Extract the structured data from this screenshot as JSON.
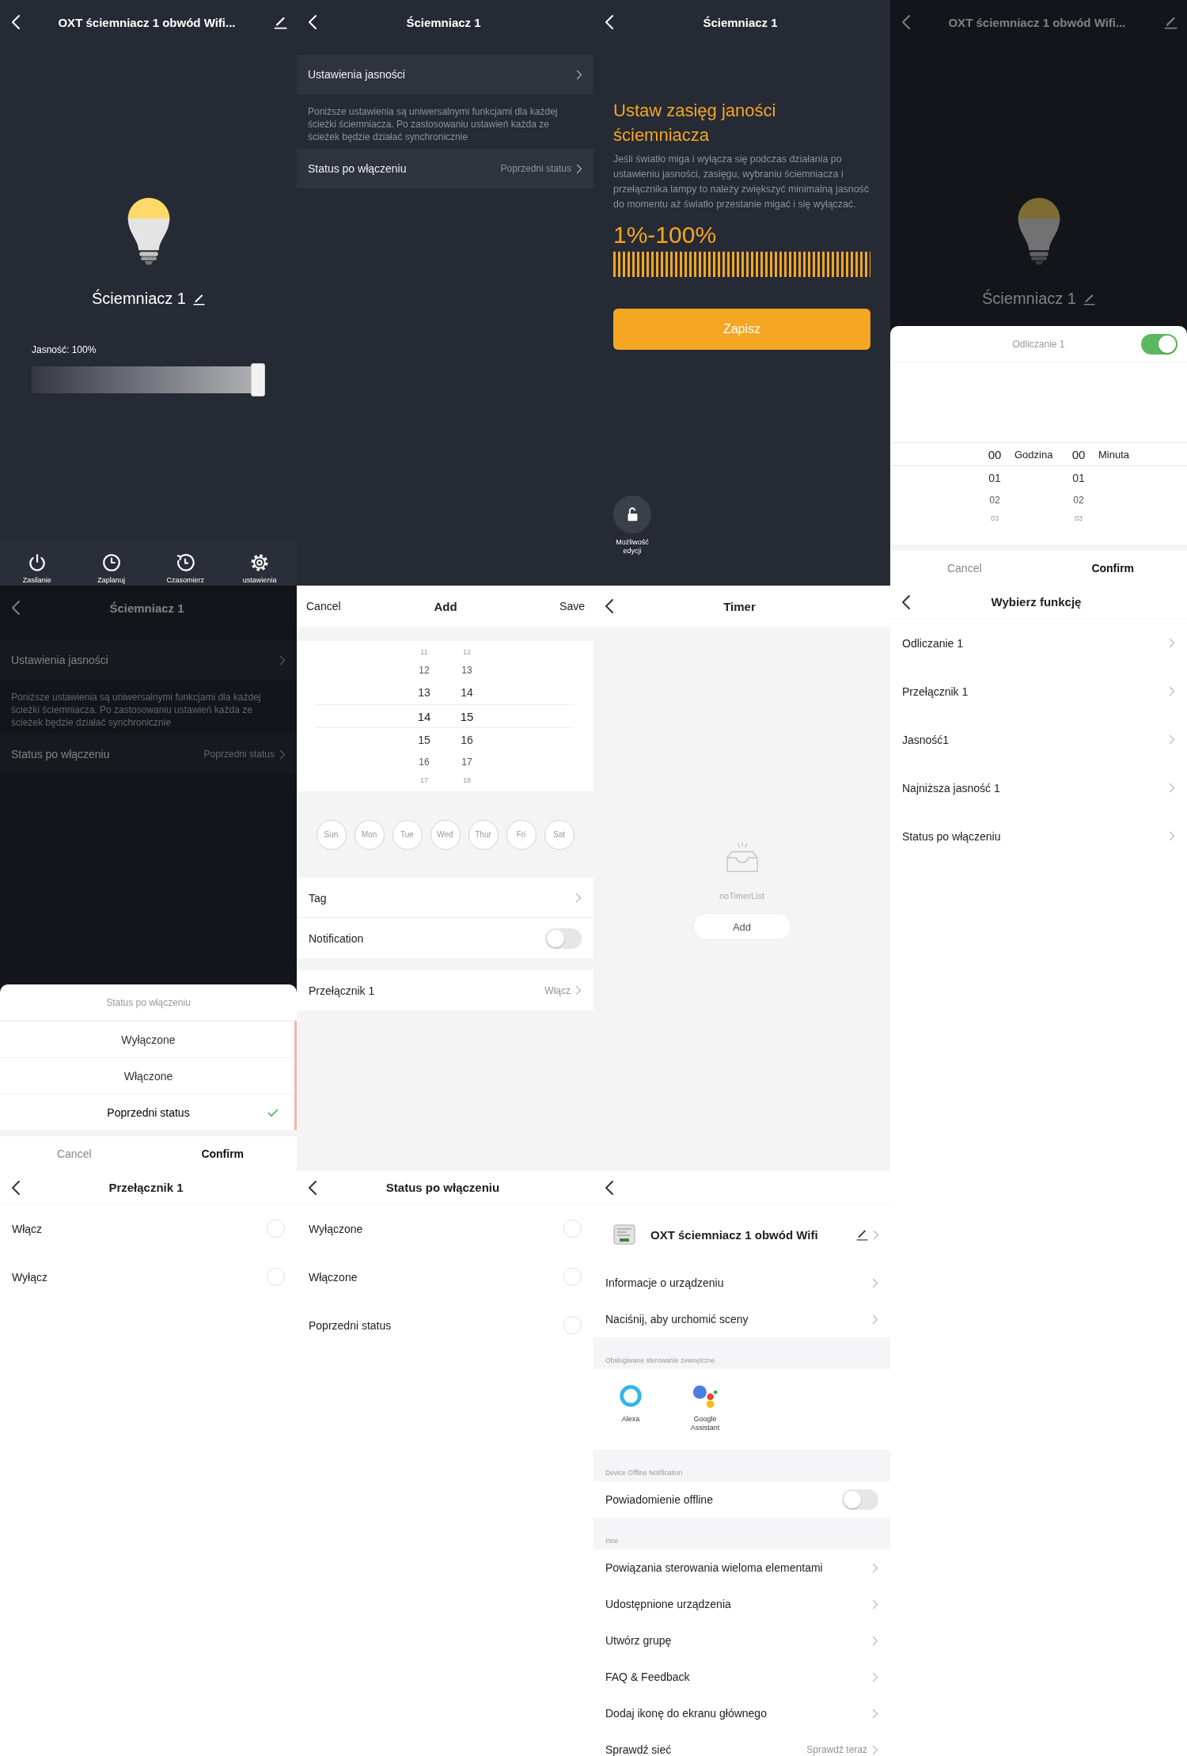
{
  "screens": [
    {
      "kind": "device",
      "dimmed": false,
      "title": "OXT ściemniacz 1 obwód Wifi...",
      "name": "Ściemniacz 1",
      "brightness": {
        "label": "Jasność: 100%",
        "level": 1
      },
      "tabs": [
        "Zasilanie",
        "Zaplanuj",
        "Czasomierz",
        "ustawienia"
      ]
    },
    {
      "kind": "settings",
      "dimmed": false,
      "title": "Ściemniacz 1",
      "items": [
        {
          "kind": "row",
          "label": "Ustawienia jasności"
        },
        {
          "kind": "note",
          "text": "Poniższe ustawienia są uniwersalnymi funkcjami dla każdej ścieżki ściemniacza. Po zastosowaniu ustawień każda ze ścieżek będzie działać synchronicznie"
        },
        {
          "kind": "row",
          "label": "Status po włączeniu",
          "value": "Poprzedni status"
        }
      ]
    },
    {
      "kind": "range",
      "title": "Ściemniacz 1",
      "heading": "Ustaw zasięg janości ściemniacza",
      "description": "Jeśli światło miga i wyłącza się podczas działania po ustawieniu jasności, zasięgu, wybraniu ściemniacza i przełącznika lampy to należy zwiększyć minimalną jasność do momentu aż światło przestanie migać i się wyłączać.",
      "range": "1%-100%",
      "save": "Zapisz",
      "lock_label": "Możliwość edycji"
    },
    {
      "kind": "device",
      "dimmed": true,
      "title": "OXT ściemniacz 1 obwód Wifi...",
      "name": "Ściemniacz 1",
      "sheet": {
        "kind": "countdown",
        "title": "Odliczanie 1",
        "on": true,
        "columns": [
          {
            "unit": "Godzina",
            "values": [
              {
                "text": "00",
                "selected": true
              },
              {
                "text": "01",
                "selected": false
              },
              {
                "text": "02",
                "selected": false
              },
              {
                "text": "03",
                "selected": false
              }
            ]
          },
          {
            "unit": "Minuta",
            "values": [
              {
                "text": "00",
                "selected": true
              },
              {
                "text": "01",
                "selected": false
              },
              {
                "text": "02",
                "selected": false
              },
              {
                "text": "03",
                "selected": false
              }
            ]
          }
        ],
        "cancel": "Cancel",
        "confirm": "Confirm"
      }
    },
    {
      "kind": "settings",
      "dimmed": true,
      "title": "Ściemniacz 1",
      "items": [
        {
          "kind": "row",
          "label": "Ustawienia jasności"
        },
        {
          "kind": "note",
          "text": "Poniższe ustawienia są uniwersalnymi funkcjami dla każdej ścieżki ściemniacza. Po zastosowaniu ustawień każda ze ścieżek będzie działać synchronicznie"
        },
        {
          "kind": "row",
          "label": "Status po włączeniu",
          "value": "Poprzedni status"
        }
      ],
      "sheet": {
        "kind": "options",
        "title": "Status po włączeniu",
        "options": [
          {
            "label": "Wyłączone",
            "selected": false
          },
          {
            "label": "Włączone",
            "selected": false
          },
          {
            "label": "Poprzedni status",
            "selected": true
          }
        ],
        "cancel": "Cancel",
        "confirm": "Confirm"
      }
    },
    {
      "kind": "add_timer",
      "cancel": "Cancel",
      "title": "Add",
      "save": "Save",
      "columns": [
        {
          "values": [
            {
              "text": "11",
              "selected": false
            },
            {
              "text": "12",
              "selected": false
            },
            {
              "text": "13",
              "selected": false
            },
            {
              "text": "14",
              "selected": true
            },
            {
              "text": "15",
              "selected": false
            },
            {
              "text": "16",
              "selected": false
            },
            {
              "text": "17",
              "selected": false
            }
          ]
        },
        {
          "values": [
            {
              "text": "12",
              "selected": false
            },
            {
              "text": "13",
              "selected": false
            },
            {
              "text": "14",
              "selected": false
            },
            {
              "text": "15",
              "selected": true
            },
            {
              "text": "16",
              "selected": false
            },
            {
              "text": "17",
              "selected": false
            },
            {
              "text": "18",
              "selected": false
            }
          ]
        }
      ],
      "days": [
        {
          "label": "Sun",
          "selected": false
        },
        {
          "label": "Mon",
          "selected": false
        },
        {
          "label": "Tue",
          "selected": false
        },
        {
          "label": "Wed",
          "selected": false
        },
        {
          "label": "Thur",
          "selected": false
        },
        {
          "label": "Fri",
          "selected": false
        },
        {
          "label": "Sat",
          "selected": false
        }
      ],
      "rows": [
        {
          "kind": "link",
          "label": "Tag"
        },
        {
          "kind": "toggle",
          "label": "Notification",
          "on": false
        },
        {
          "kind": "link",
          "label": "Przełącznik 1",
          "value": "Włącz"
        }
      ]
    },
    {
      "kind": "timer",
      "title": "Timer",
      "empty_text": "noTimerList",
      "add": "Add"
    },
    {
      "kind": "list",
      "title": "Wybierz funkcję",
      "items": [
        "Odliczanie 1",
        "Przełącznik 1",
        "Jasność1",
        "Najniższa jasność 1",
        "Status po włączeniu"
      ]
    },
    {
      "kind": "radio",
      "title": "Przełącznik 1",
      "options": [
        {
          "label": "Włącz",
          "selected": false
        },
        {
          "label": "Wyłącz",
          "selected": false
        }
      ]
    },
    {
      "kind": "radio",
      "title": "Status po włączeniu",
      "options": [
        {
          "label": "Wyłączone",
          "selected": false
        },
        {
          "label": "Włączone",
          "selected": false
        },
        {
          "label": "Poprzedni status",
          "selected": false
        }
      ]
    },
    {
      "kind": "device_settings",
      "device_name": "OXT ściemniacz 1 obwód Wifi",
      "top_rows": [
        "Informacje o urządzeniu",
        "Naciśnij, aby urchomić sceny"
      ],
      "voice": {
        "label": "Obsługiwane sterowanie zewnętrzne",
        "services": [
          "Alexa",
          "Google Assistant"
        ]
      },
      "offline": {
        "label": "Device Offline Notification",
        "row": "Powiadomienie offline",
        "on": false
      },
      "other": {
        "label": "Inne",
        "rows": [
          {
            "label": "Powiązania sterowania wieloma elementami"
          },
          {
            "label": "Udostępnione urządzenia"
          },
          {
            "label": "Utwórz grupę"
          },
          {
            "label": "FAQ & Feedback"
          },
          {
            "label": "Dodaj ikonę do ekranu głównego"
          },
          {
            "label": "Sprawdź sieć",
            "value": "Sprawdź teraz"
          }
        ]
      }
    }
  ]
}
